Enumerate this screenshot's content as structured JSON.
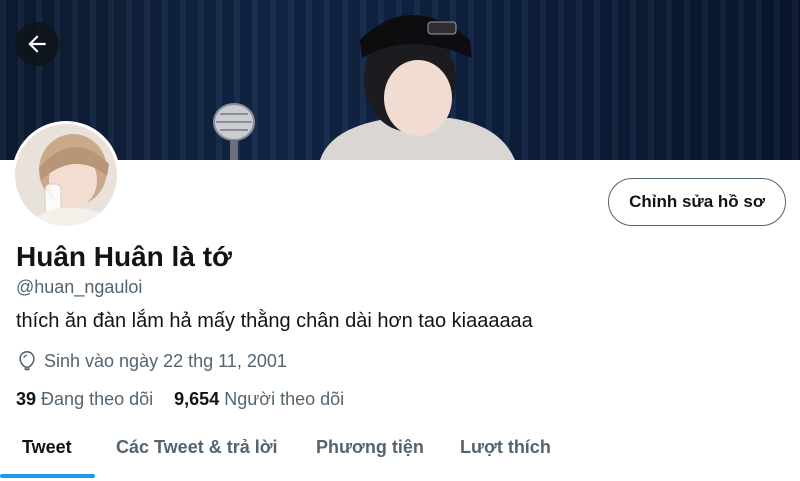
{
  "profile": {
    "display_name": "Huân Huân là tớ",
    "handle": "@huan_ngauloi",
    "bio": "thích ăn đàn lắm hả mấy thằng chân dài hơn tao kiaaaaaa",
    "birthday": "Sinh vào ngày 22 thg 11, 2001"
  },
  "header": {
    "edit_profile_label": "Chỉnh sửa hồ sơ"
  },
  "stats": {
    "following_count": "39",
    "following_label": "Đang theo dõi",
    "followers_count": "9,654",
    "followers_label": "Người theo dõi"
  },
  "tabs": [
    {
      "label": "Tweet",
      "active": true
    },
    {
      "label": "Các Tweet & trả lời",
      "active": false
    },
    {
      "label": "Phương tiện",
      "active": false
    },
    {
      "label": "Lượt thích",
      "active": false
    }
  ],
  "colors": {
    "accent": "#1d9bf0",
    "text_primary": "#0f1419",
    "text_secondary": "#536471"
  },
  "icons": {
    "back": "arrow-left-icon",
    "birthday": "balloon-icon"
  }
}
